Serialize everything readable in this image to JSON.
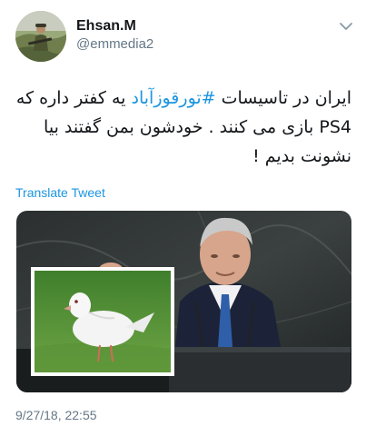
{
  "user": {
    "display_name": "Ehsan.M",
    "handle": "@emmedia2"
  },
  "tweet": {
    "line1_before": "ایران در تاسیسات ",
    "hashtag": "#تورقوزآباد",
    "line1_after": " یه کفتر داره که",
    "line2": "PS4 بازی می کنند . خودشون بمن گفتند بیا",
    "line3": "نشونت بدیم !",
    "translate_label": "Translate Tweet",
    "timestamp": "9/27/18, 22:55"
  },
  "colors": {
    "link": "#1b95e0",
    "secondary_text": "#657786",
    "primary_text": "#14171a"
  },
  "icons": {
    "menu": "chevron-down-icon"
  }
}
